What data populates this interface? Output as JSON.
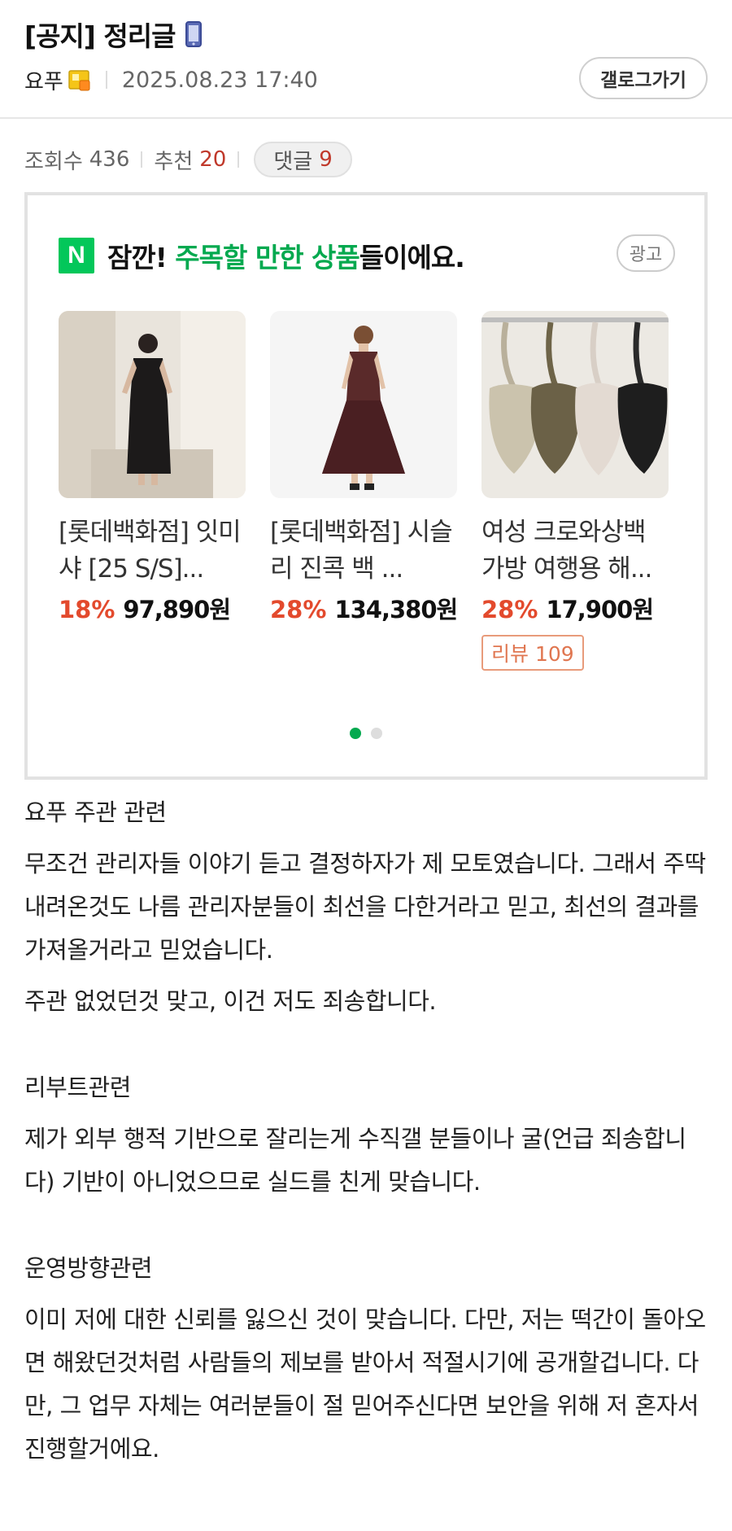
{
  "header": {
    "title": "[공지] 정리글",
    "author": "요푸",
    "date": "2025.08.23 17:40",
    "gallery_button": "갤로그가기"
  },
  "stats": {
    "views_label": "조회수",
    "views": "436",
    "recommend_label": "추천",
    "recommend": "20",
    "comments_label": "댓글",
    "comments": "9"
  },
  "ad": {
    "logo": "N",
    "title_prefix": "잠깐! ",
    "title_highlight": "주목할 만한 상품",
    "title_suffix": "들이에요.",
    "badge": "광고",
    "products": [
      {
        "name": "[롯데백화점] 잇미샤 [25 S/S]...",
        "discount": "18%",
        "price": "97,890원"
      },
      {
        "name": "[롯데백화점] 시슬리 진콕 백 ...",
        "discount": "28%",
        "price": "134,380원"
      },
      {
        "name": "여성 크로와상백 가방 여행용 해...",
        "discount": "28%",
        "price": "17,900원",
        "review": "리뷰 109"
      }
    ],
    "page_count": 2,
    "active_page": 1
  },
  "body": {
    "s1_heading": "요푸 주관 관련",
    "s1_p1": "무조건 관리자들 이야기 듣고 결정하자가 제 모토였습니다. 그래서 주딱 내려온것도 나름 관리자분들이 최선을 다한거라고 믿고, 최선의 결과를 가져올거라고 믿었습니다.",
    "s1_p2": "주관 없었던것 맞고, 이건 저도 죄송합니다.",
    "s2_heading": "리부트관련",
    "s2_p1": "제가 외부 행적 기반으로 잘리는게 수직갤 분들이나 굴(언급 죄송합니다) 기반이 아니었으므로 실드를 친게 맞습니다.",
    "s3_heading": "운영방향관련",
    "s3_p1": "이미 저에 대한 신뢰를 잃으신 것이 맞습니다. 다만, 저는 떡간이 돌아오면 해왔던것처럼 사람들의 제보를 받아서 적절시기에 공개할겁니다. 다만, 그 업무 자체는 여러분들이 절 믿어주신다면 보안을 위해 저 혼자서 진행할거에요."
  },
  "colors": {
    "accent_green": "#03a94f",
    "naver_green": "#03c75a",
    "discount_red": "#e34a2d",
    "recommend_red": "#c0392b"
  }
}
